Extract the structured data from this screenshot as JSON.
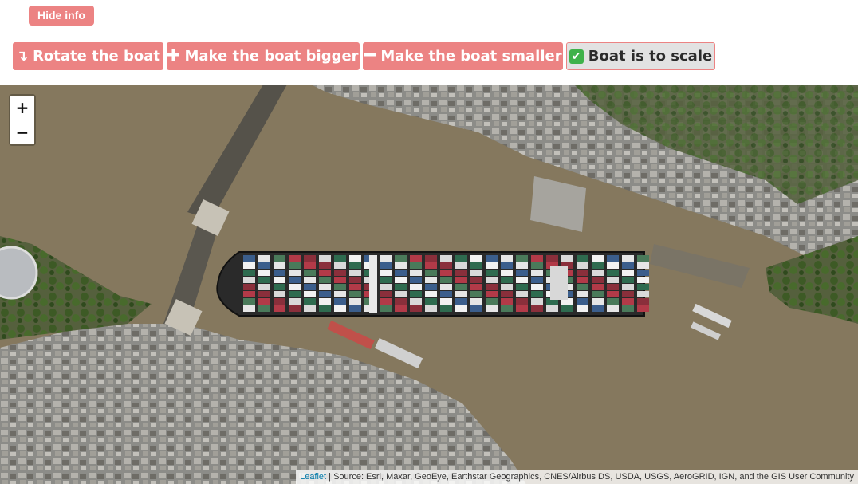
{
  "info": {
    "hide_label": "Hide info"
  },
  "toolbar": {
    "rotate": {
      "icon": "rotate-arrow-icon",
      "glyph": "↴",
      "label": "Rotate the boat"
    },
    "bigger": {
      "icon": "plus-icon",
      "glyph": "➕",
      "label": "Make the boat bigger"
    },
    "smaller": {
      "icon": "minus-icon",
      "glyph": "➖",
      "label": "Make the boat smaller"
    },
    "scale": {
      "icon": "check-mark-icon",
      "glyph": "✔",
      "label": "Boat is to scale",
      "active": true
    }
  },
  "map": {
    "zoom_in": "+",
    "zoom_out": "−",
    "attribution": {
      "link": "Leaflet",
      "separator": " | ",
      "source": "Source: Esri, Maxar, GeoEye, Earthstar Geographics, CNES/Airbus DS, USDA, USGS, AeroGRID, IGN, and the GIS User Community"
    }
  },
  "colors": {
    "button_bg": "#ec8383",
    "button_active_bg": "#e2e2e2",
    "water": "#85785e",
    "land": "#8e8e8a"
  }
}
